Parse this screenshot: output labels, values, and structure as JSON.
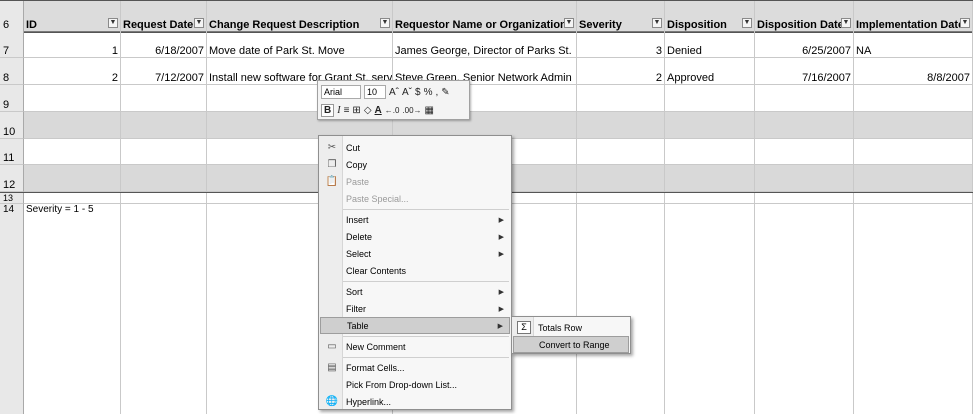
{
  "sheet": {
    "headers": [
      "ID",
      "Request Date",
      "Change Request Description",
      "Requestor Name or Organization",
      "Severity",
      "Disposition",
      "Disposition Date",
      "Implementation Date"
    ],
    "rows": [
      {
        "num": "7",
        "id": "1",
        "request_date": "6/18/2007",
        "description": "Move date of Park St. Move",
        "requestor": "James George, Director of Parks St.",
        "severity": "3",
        "disposition": "Denied",
        "disposition_date": "6/25/2007",
        "implementation_date": "NA"
      },
      {
        "num": "8",
        "id": "2",
        "request_date": "7/12/2007",
        "description": "Install new software for Grant St. server",
        "requestor": "Steve Green, Senior Network Admin",
        "severity": "2",
        "disposition": "Approved",
        "disposition_date": "7/16/2007",
        "implementation_date": "8/8/2007"
      }
    ],
    "row_numbers": [
      "6",
      "9",
      "10",
      "11",
      "12",
      "13",
      "14"
    ],
    "note": "Severity = 1 - 5"
  },
  "mini_toolbar": {
    "font": "Arial",
    "size": "10",
    "grow": "Aˆ",
    "shrink": "Aˇ",
    "currency": "$",
    "percent": "%",
    "comma": ",",
    "bold": "B",
    "italic": "I"
  },
  "context_menu": {
    "items": [
      {
        "label": "Cut",
        "icon": "scissors-icon"
      },
      {
        "label": "Copy",
        "icon": "copy-icon"
      },
      {
        "label": "Paste",
        "icon": "paste-icon",
        "disabled": true
      },
      {
        "label": "Paste Special...",
        "disabled": true
      },
      {
        "label": "Insert",
        "submenu": true
      },
      {
        "label": "Delete",
        "submenu": true
      },
      {
        "label": "Select",
        "submenu": true
      },
      {
        "label": "Clear Contents"
      },
      {
        "label": "Sort",
        "submenu": true
      },
      {
        "label": "Filter",
        "submenu": true
      },
      {
        "label": "Table",
        "submenu": true,
        "highlighted": true
      },
      {
        "label": "New Comment",
        "icon": "comment-icon"
      },
      {
        "label": "Format Cells...",
        "icon": "format-cells-icon"
      },
      {
        "label": "Pick From Drop-down List..."
      },
      {
        "label": "Hyperlink...",
        "icon": "hyperlink-icon"
      }
    ]
  },
  "table_submenu": {
    "items": [
      {
        "label": "Totals Row",
        "icon": "sigma-icon"
      },
      {
        "label": "Convert to Range",
        "highlighted": true
      }
    ]
  }
}
